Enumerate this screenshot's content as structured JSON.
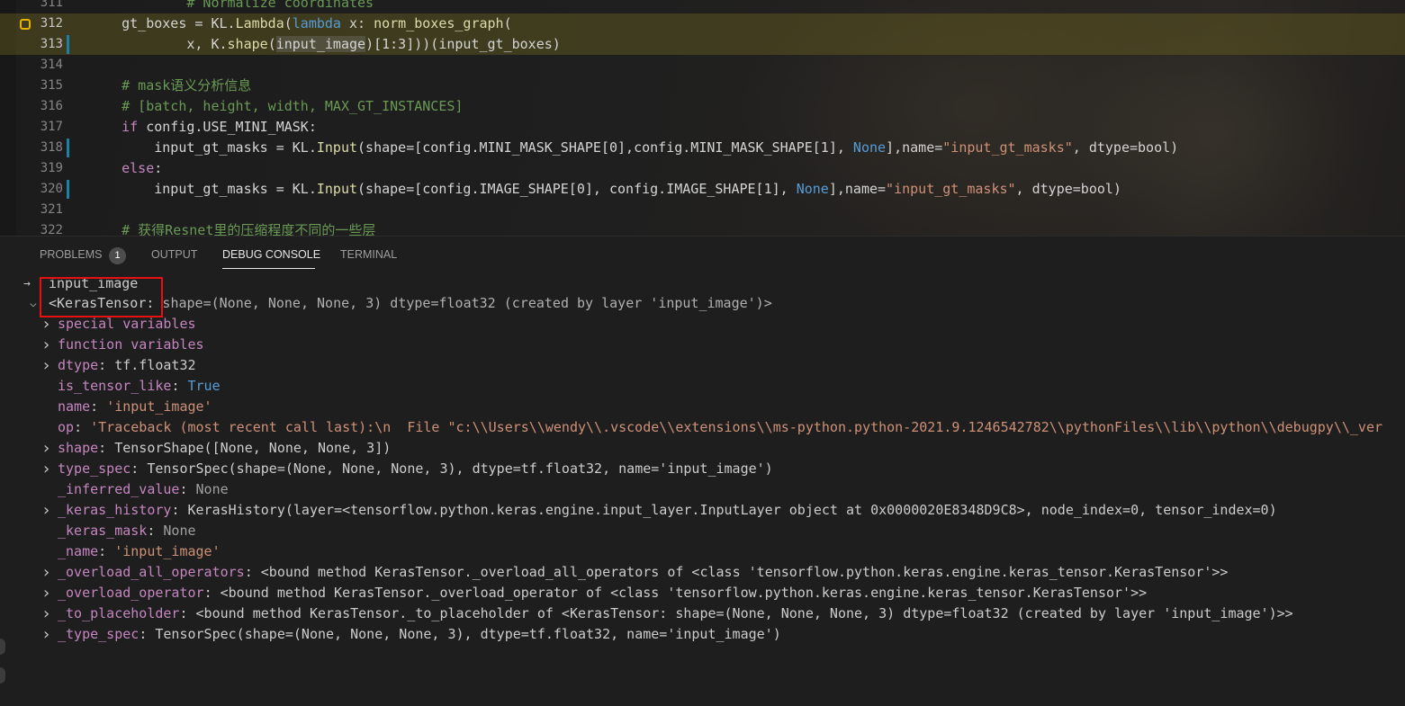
{
  "editor": {
    "lines": [
      {
        "num": "311",
        "segments": [
          {
            "t": "            ",
            "c": ""
          },
          {
            "t": "# Normalize coordinates",
            "c": "cm"
          }
        ]
      },
      {
        "num": "312",
        "segments": [
          {
            "t": "    gt_boxes = KL.",
            "c": ""
          },
          {
            "t": "Lambda",
            "c": "fn"
          },
          {
            "t": "(",
            "c": ""
          },
          {
            "t": "lambda",
            "c": "kw"
          },
          {
            "t": " x: ",
            "c": ""
          },
          {
            "t": "norm_boxes_graph",
            "c": "fn"
          },
          {
            "t": "(",
            "c": ""
          }
        ]
      },
      {
        "num": "313",
        "segments": [
          {
            "t": "            x, K.",
            "c": ""
          },
          {
            "t": "shape",
            "c": "fn"
          },
          {
            "t": "(",
            "c": ""
          },
          {
            "t": "input_image",
            "c": "sel"
          },
          {
            "t": ")[1:3]))(input_gt_boxes)",
            "c": ""
          }
        ]
      },
      {
        "num": "314",
        "segments": []
      },
      {
        "num": "315",
        "segments": [
          {
            "t": "    ",
            "c": ""
          },
          {
            "t": "# mask语义分析信息",
            "c": "cm"
          }
        ]
      },
      {
        "num": "316",
        "segments": [
          {
            "t": "    ",
            "c": ""
          },
          {
            "t": "# [batch, height, width, MAX_GT_INSTANCES]",
            "c": "cm"
          }
        ]
      },
      {
        "num": "317",
        "segments": [
          {
            "t": "    ",
            "c": ""
          },
          {
            "t": "if",
            "c": "kw2"
          },
          {
            "t": " config.USE_MINI_MASK:",
            "c": ""
          }
        ]
      },
      {
        "num": "318",
        "segments": [
          {
            "t": "        input_gt_masks = KL.",
            "c": ""
          },
          {
            "t": "Input",
            "c": "fn"
          },
          {
            "t": "(shape=[config.MINI_MASK_SHAPE[0],config.MINI_MASK_SHAPE[1], ",
            "c": ""
          },
          {
            "t": "None",
            "c": "kw"
          },
          {
            "t": "],name=",
            "c": ""
          },
          {
            "t": "\"input_gt_masks\"",
            "c": "st"
          },
          {
            "t": ", dtype=bool)",
            "c": ""
          }
        ]
      },
      {
        "num": "319",
        "segments": [
          {
            "t": "    ",
            "c": ""
          },
          {
            "t": "else",
            "c": "kw2"
          },
          {
            "t": ":",
            "c": ""
          }
        ]
      },
      {
        "num": "320",
        "segments": [
          {
            "t": "        input_gt_masks = KL.",
            "c": ""
          },
          {
            "t": "Input",
            "c": "fn"
          },
          {
            "t": "(shape=[config.IMAGE_SHAPE[0], config.IMAGE_SHAPE[1], ",
            "c": ""
          },
          {
            "t": "None",
            "c": "kw"
          },
          {
            "t": "],name=",
            "c": ""
          },
          {
            "t": "\"input_gt_masks\"",
            "c": "st"
          },
          {
            "t": ", dtype=bool)",
            "c": ""
          }
        ]
      },
      {
        "num": "321",
        "segments": []
      },
      {
        "num": "322",
        "segments": [
          {
            "t": "    ",
            "c": ""
          },
          {
            "t": "# 获得Resnet里的压缩程度不同的一些层",
            "c": "cm"
          }
        ]
      }
    ],
    "current_line": "312"
  },
  "panel": {
    "tabs": [
      "PROBLEMS",
      "OUTPUT",
      "DEBUG CONSOLE",
      "TERMINAL"
    ],
    "problems_count": "1",
    "active_tab": "DEBUG CONSOLE"
  },
  "console": {
    "input_echo": "input_image",
    "result_head": "<KerasTensor:",
    "result_tail": " shape=(None, None, None, 3) dtype=float32 (created by layer 'input_image')>",
    "items": [
      {
        "expand": true,
        "key": "special variables",
        "val": "",
        "vc": ""
      },
      {
        "expand": true,
        "key": "function variables",
        "val": "",
        "vc": ""
      },
      {
        "expand": true,
        "key": "dtype",
        "val": "tf.float32",
        "vc": "v-obj"
      },
      {
        "expand": false,
        "key": "is_tensor_like",
        "val": "True",
        "vc": "v-bool"
      },
      {
        "expand": false,
        "key": "name",
        "val": "'input_image'",
        "vc": "v-str"
      },
      {
        "expand": false,
        "key": "op",
        "val": "'Traceback (most recent call last):\\n  File \"c:\\\\Users\\\\wendy\\\\.vscode\\\\extensions\\\\ms-python.python-2021.9.1246542782\\\\pythonFiles\\\\lib\\\\python\\\\debugpy\\\\_ver",
        "vc": "v-str"
      },
      {
        "expand": true,
        "key": "shape",
        "val": "TensorShape([None, None, None, 3])",
        "vc": "v-obj"
      },
      {
        "expand": true,
        "key": "type_spec",
        "val": "TensorSpec(shape=(None, None, None, 3), dtype=tf.float32, name='input_image')",
        "vc": "v-obj"
      },
      {
        "expand": false,
        "key": "_inferred_value",
        "val": "None",
        "vc": "v-grey"
      },
      {
        "expand": true,
        "key": "_keras_history",
        "val": "KerasHistory(layer=<tensorflow.python.keras.engine.input_layer.InputLayer object at 0x0000020E8348D9C8>, node_index=0, tensor_index=0)",
        "vc": "v-obj"
      },
      {
        "expand": false,
        "key": "_keras_mask",
        "val": "None",
        "vc": "v-grey"
      },
      {
        "expand": false,
        "key": "_name",
        "val": "'input_image'",
        "vc": "v-str"
      },
      {
        "expand": true,
        "key": "_overload_all_operators",
        "val": "<bound method KerasTensor._overload_all_operators of <class 'tensorflow.python.keras.engine.keras_tensor.KerasTensor'>>",
        "vc": "v-obj"
      },
      {
        "expand": true,
        "key": "_overload_operator",
        "val": "<bound method KerasTensor._overload_operator of <class 'tensorflow.python.keras.engine.keras_tensor.KerasTensor'>>",
        "vc": "v-obj"
      },
      {
        "expand": true,
        "key": "_to_placeholder",
        "val": "<bound method KerasTensor._to_placeholder of <KerasTensor: shape=(None, None, None, 3) dtype=float32 (created by layer 'input_image')>>",
        "vc": "v-obj"
      },
      {
        "expand": true,
        "key": "_type_spec",
        "val": "TensorSpec(shape=(None, None, None, 3), dtype=tf.float32, name='input_image')",
        "vc": "v-obj"
      }
    ]
  },
  "colors": {
    "highlight_line": "#6e641e",
    "breakpoint": "#e8b200",
    "annotation_box": "#e81010",
    "property_key": "#c586c0",
    "string_value": "#ce9178"
  },
  "icons": {
    "twisty_collapsed": "chevron-right-icon",
    "twisty_expanded": "chevron-down-icon",
    "input_arrow": "arrow-right-icon",
    "breakpoint": "debug-stackframe-icon"
  }
}
